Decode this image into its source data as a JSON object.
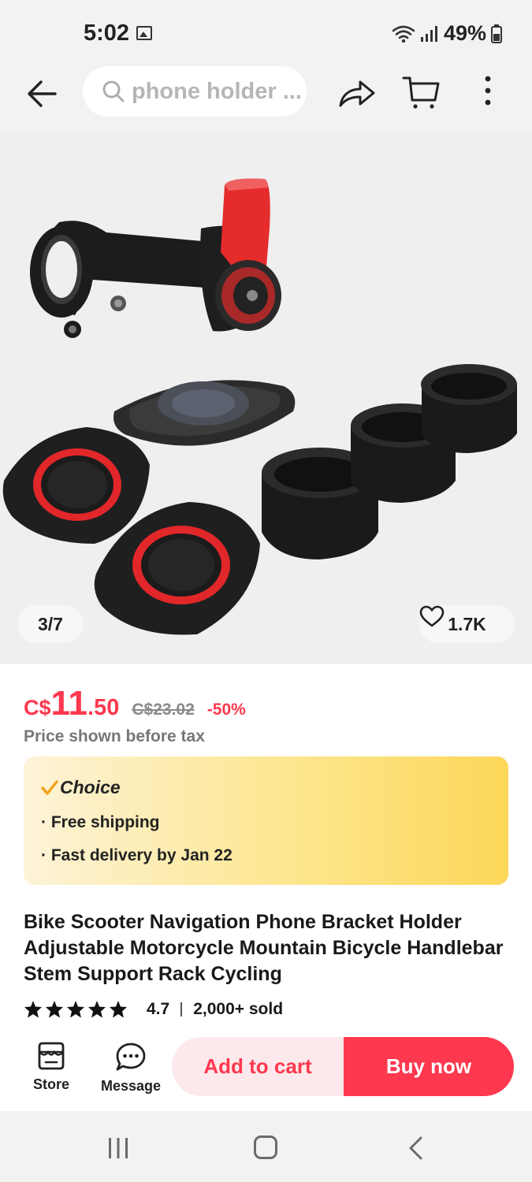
{
  "status_bar": {
    "time": "5:02",
    "battery": "49%"
  },
  "header": {
    "search_placeholder": "phone holder ..."
  },
  "gallery": {
    "counter": "3/7",
    "wishlist_count": "1.7K"
  },
  "price": {
    "currency": "C$",
    "integer": "11",
    "decimal": ".50",
    "original": "C$23.02",
    "discount": "-50%",
    "tax_note": "Price shown before tax"
  },
  "choice": {
    "label": "Choice",
    "features": [
      "· Free shipping",
      "· Fast delivery by Jan 22"
    ],
    "colors": {
      "gradient_start": "#fdf3d8",
      "gradient_end": "#fcd759"
    }
  },
  "product": {
    "title": "Bike Scooter Navigation Phone Bracket Holder Adjustable Motorcycle Mountain Bicycle Handlebar Stem Support Rack Cycling",
    "rating": "4.7",
    "rating_stars": 5,
    "sold": "2,000+ sold"
  },
  "actions": {
    "store_label": "Store",
    "message_label": "Message",
    "add_to_cart": "Add to cart",
    "buy_now": "Buy now"
  },
  "colors": {
    "accent": "#fd384f",
    "accent_light": "#fde9eb"
  },
  "icons": [
    "picture-icon",
    "wifi-icon",
    "signal-icon",
    "battery-icon",
    "back-arrow-icon",
    "search-icon",
    "share-icon",
    "cart-icon",
    "more-vertical-icon",
    "heart-icon",
    "check-icon",
    "star-icon",
    "store-icon",
    "message-icon",
    "recent-apps-icon",
    "home-icon",
    "nav-back-icon"
  ]
}
